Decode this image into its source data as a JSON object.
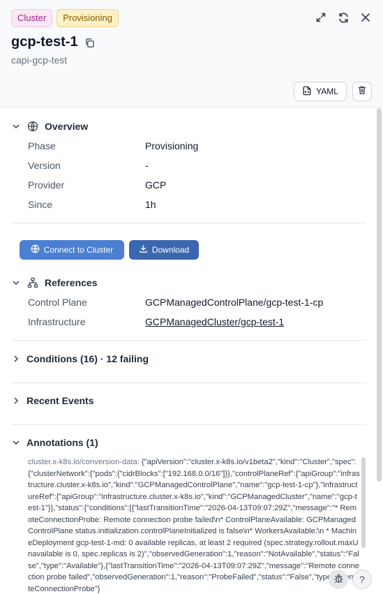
{
  "header": {
    "badges": [
      "Cluster",
      "Provisioning"
    ],
    "title": "gcp-test-1",
    "subtitle": "capi-gcp-test",
    "yaml_label": "YAML"
  },
  "overview": {
    "title": "Overview",
    "rows": [
      {
        "key": "Phase",
        "value": "Provisioning"
      },
      {
        "key": "Version",
        "value": "-"
      },
      {
        "key": "Provider",
        "value": "GCP"
      },
      {
        "key": "Since",
        "value": "1h"
      }
    ]
  },
  "actions": {
    "connect_label": "Connect to Cluster",
    "download_label": "Download"
  },
  "references": {
    "title": "References",
    "rows": [
      {
        "key": "Control Plane",
        "value": "GCPManagedControlPlane/gcp-test-1-cp"
      },
      {
        "key": "Infrastructure",
        "value": "GCPManagedCluster/gcp-test-1"
      }
    ]
  },
  "conditions": {
    "title": "Conditions (16) · 12 failing"
  },
  "events": {
    "title": "Recent Events"
  },
  "annotations": {
    "title": "Annotations (1)",
    "key": "cluster.x-k8s.io/conversion-data:",
    "value": "{\"apiVersion\":\"cluster.x-k8s.io/v1beta2\",\"kind\":\"Cluster\",\"spec\":{\"clusterNetwork\":{\"pods\":{\"cidrBlocks\":[\"192.168.0.0/16\"]}},\"controlPlaneRef\":{\"apiGroup\":\"infrastructure.cluster.x-k8s.io\",\"kind\":\"GCPManagedControlPlane\",\"name\":\"gcp-test-1-cp\"},\"infrastructureRef\":{\"apiGroup\":\"infrastructure.cluster.x-k8s.io\",\"kind\":\"GCPManagedCluster\",\"name\":\"gcp-test-1\"}},\"status\":{\"conditions\":[{\"lastTransitionTime\":\"2026-04-13T09:07:29Z\",\"message\":\"* RemoteConnectionProbe: Remote connection probe failed\\n* ControlPlaneAvailable: GCPManagedControlPlane status.initialization.controlPlaneInitialized is false\\n* WorkersAvailable:\\n * MachineDeployment gcp-test-1-md: 0 available replicas, at least 2 required (spec.strategy.rollout.maxUnavailable is 0, spec.replicas is 2)\",\"observedGeneration\":1,\"reason\":\"NotAvailable\",\"status\":\"False\",\"type\":\"Available\"},{\"lastTransitionTime\":\"2026-04-13T09:07:29Z\",\"message\":\"Remote connection probe failed\",\"observedGeneration\":1,\"reason\":\"ProbeFailed\",\"status\":\"False\",\"type\":\"RemoteConnectionProbe\"}"
  },
  "fab": {
    "help_label": "?"
  }
}
